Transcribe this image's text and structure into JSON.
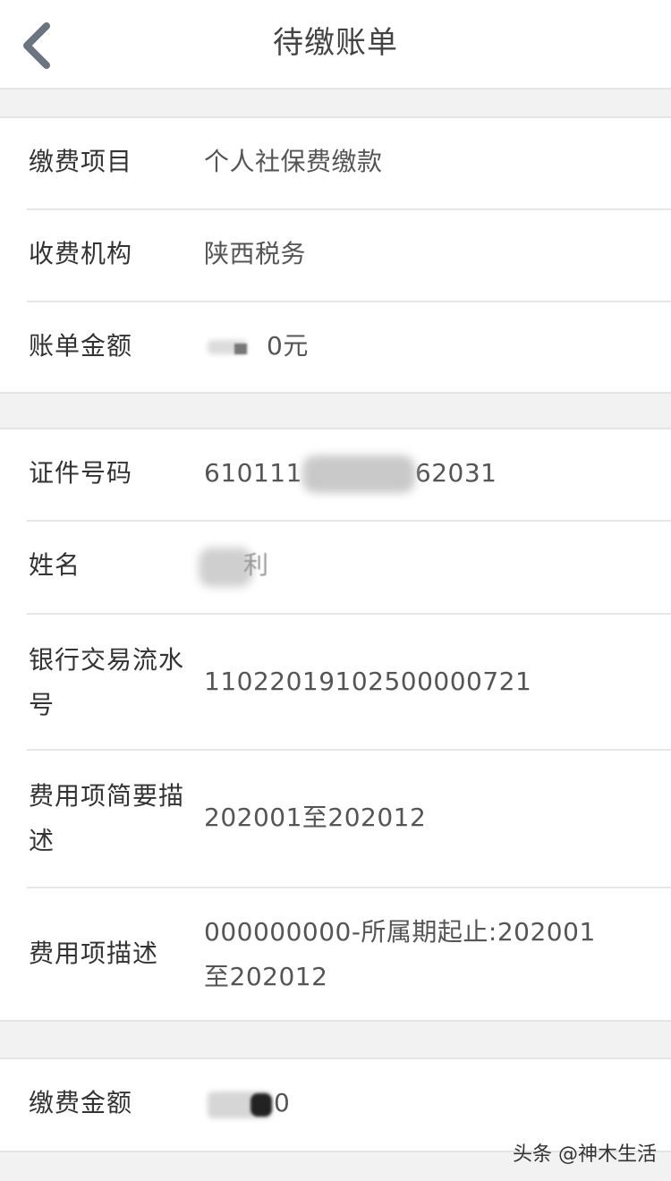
{
  "header": {
    "back_icon": "chevron-left-icon",
    "title": "待缴账单"
  },
  "section1": {
    "rows": [
      {
        "label": "缴费项目",
        "value": "个人社保费缴款"
      },
      {
        "label": "收费机构",
        "value": "陕西税务"
      },
      {
        "label": "账单金额",
        "value": "0元"
      }
    ]
  },
  "section2": {
    "rows": [
      {
        "label": "证件号码",
        "value": "610111",
        "value_tail": "62031"
      },
      {
        "label": "姓名",
        "value": "利"
      },
      {
        "label": "银行交易流水号",
        "value": "11022019102500000721"
      },
      {
        "label": "费用项简要描述",
        "value": "202001至202012"
      },
      {
        "label": "费用项描述",
        "value": "000000000-所属期起止:202001至202012"
      }
    ]
  },
  "section3": {
    "rows": [
      {
        "label": "缴费金额",
        "value": "0"
      }
    ]
  },
  "watermark": "头条 @神木生活"
}
